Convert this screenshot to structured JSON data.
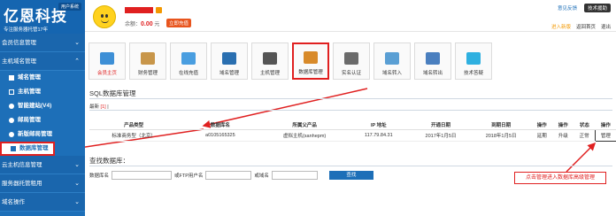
{
  "sidebar": {
    "brand": "亿恩科技",
    "slogan": "专注服务器托管17年",
    "tag": "用户系统",
    "groups": {
      "member": "会员信息管理",
      "host_domain": "主机域名管理",
      "cloud": "云主机信息管理",
      "server": "服务器托管租用",
      "domain_ops": "域名操作"
    },
    "items": {
      "domain_mgmt": "域名管理",
      "host_mgmt": "主机管理",
      "smart_site": "智能建站(V4)",
      "mailbox": "邮局管理",
      "new_mailbox": "新版邮局管理",
      "db_mgmt": "数据库管理"
    }
  },
  "topbar": {
    "balance_label": "余额：",
    "balance_value": "0.00",
    "balance_unit": "元",
    "recharge": "立即充值",
    "feedback": "意见反馈",
    "support": "技术援助",
    "enter_new": "进入新版",
    "back_home": "返回首页",
    "logout": "退出"
  },
  "tiles": [
    {
      "label": "会员主页",
      "color": "#3d8fd6",
      "red": true
    },
    {
      "label": "财务管理",
      "color": "#c8964a"
    },
    {
      "label": "在线充值",
      "color": "#4a9ee0"
    },
    {
      "label": "域名管理",
      "color": "#2a6fb0"
    },
    {
      "label": "主机管理",
      "color": "#555555"
    },
    {
      "label": "数据库管理",
      "color": "#d88a2a",
      "highlight": true
    },
    {
      "label": "实名认证",
      "color": "#6b6b6b"
    },
    {
      "label": "域名转入",
      "color": "#5a9fd4"
    },
    {
      "label": "域名转出",
      "color": "#4a7fbf"
    },
    {
      "label": "技术答疑",
      "color": "#2fb0e0"
    }
  ],
  "page": {
    "title": "SQL数据库管理",
    "tab_label": "最新",
    "tab_count": "[1]",
    "tab_sep": "|"
  },
  "table": {
    "headers": [
      "产品类型",
      "数据库名",
      "所属父产品",
      "IP 地址",
      "开通日期",
      "到期日期",
      "操作",
      "操作",
      "状态",
      "操作"
    ],
    "row": {
      "type": "标准商务型（北京）",
      "db": "a0105165325",
      "parent": "虚拟主机(sanhepm)",
      "ip": "117.79.84.31",
      "open": "2017年1月5日",
      "expire": "2018年1月5日",
      "renew": "延期",
      "upgrade": "升级",
      "status": "正常",
      "manage": "管理"
    }
  },
  "search": {
    "title": "查找数据库：",
    "db_label": "数据库名",
    "ftp_label": "或FTP用户名",
    "domain_label": "或域名",
    "button": "查找"
  },
  "callout": "点击管理进入数据库高级管理"
}
